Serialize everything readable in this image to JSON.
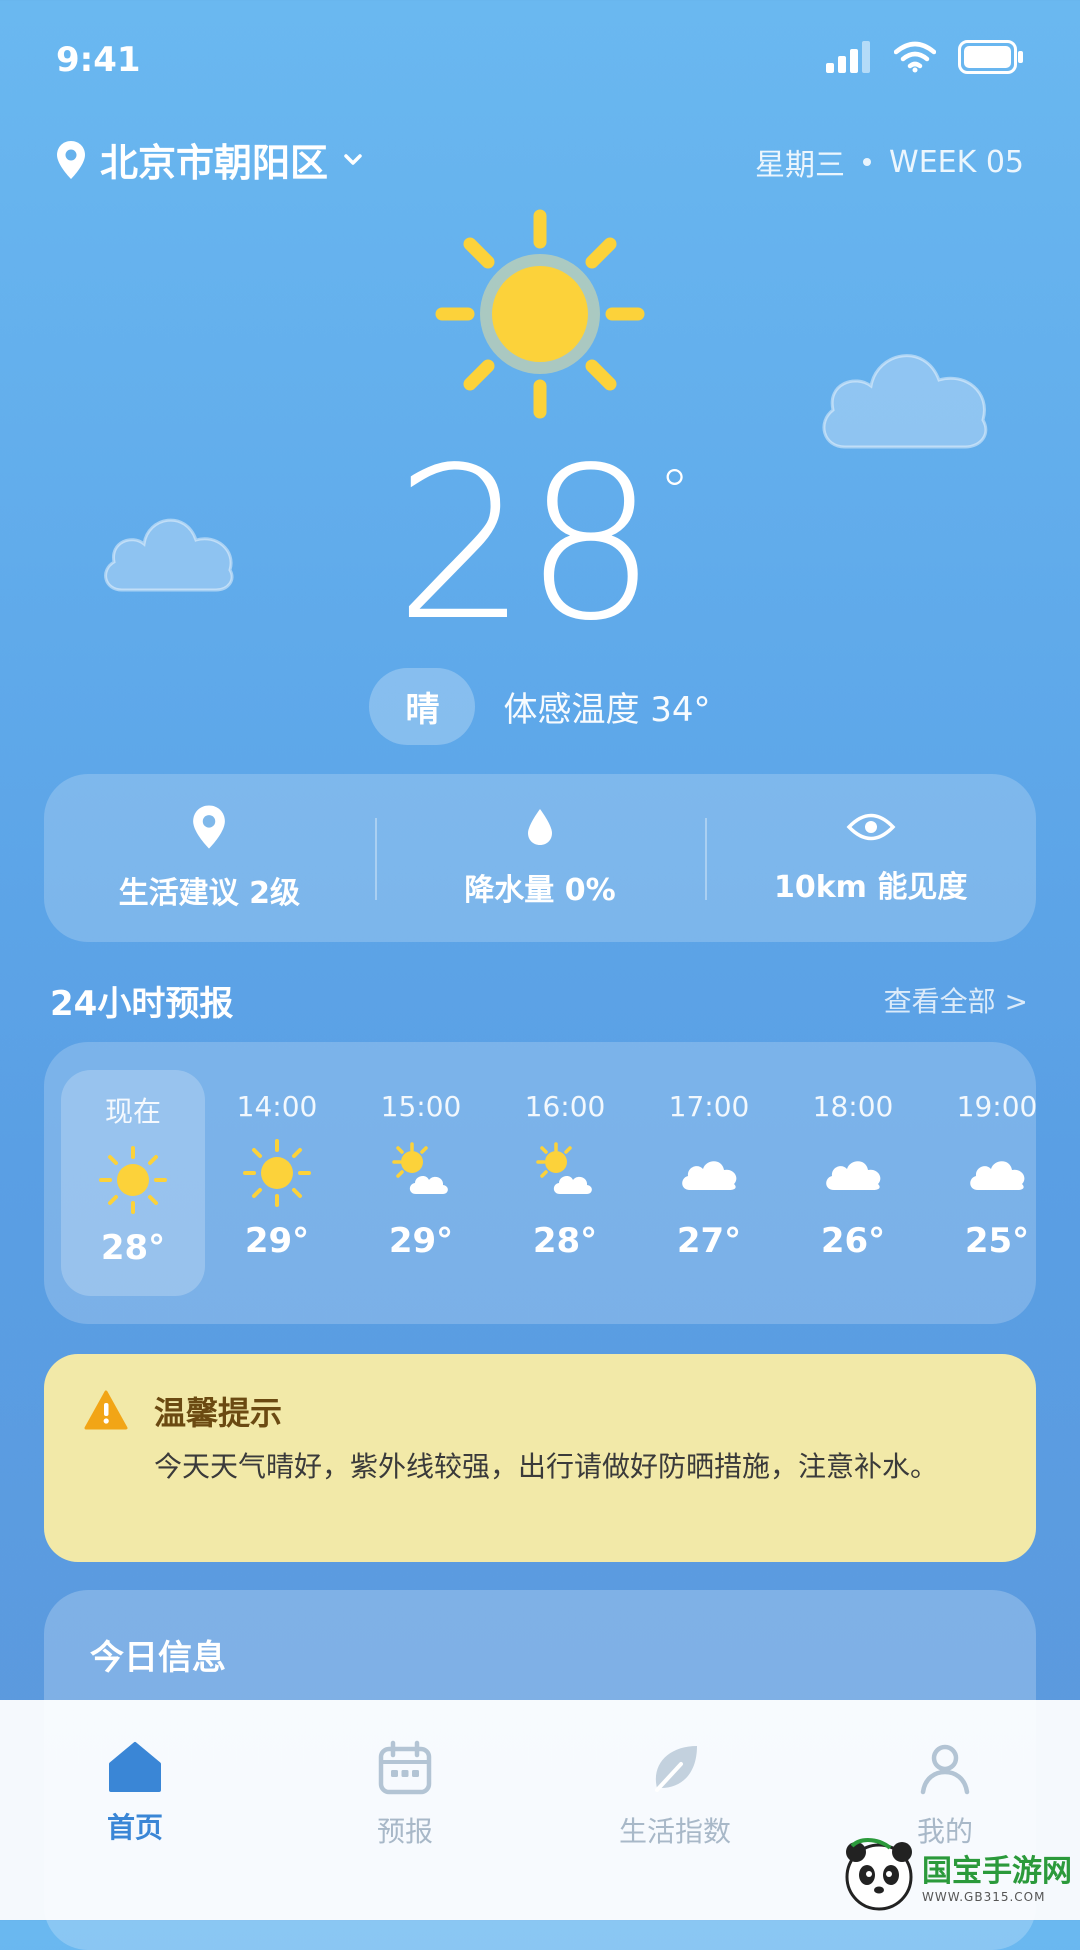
{
  "status_bar": {
    "time": "9:41"
  },
  "location": {
    "name": "北京市朝阳区"
  },
  "date": {
    "weekday": "星期三",
    "week": "WEEK 05"
  },
  "current": {
    "temperature": "28",
    "degree_symbol": "°",
    "condition": "晴",
    "feels_like": "体感温度 34°"
  },
  "stats": [
    {
      "icon": "location-pin-icon",
      "label": "生活建议 2级"
    },
    {
      "icon": "raindrop-icon",
      "label": "降水量 0%"
    },
    {
      "icon": "eye-icon",
      "label": "10km 能见度"
    }
  ],
  "hourly_section": {
    "title": "24小时预报",
    "see_all": "查看全部 >"
  },
  "hourly": [
    {
      "time": "现在",
      "icon": "sun-icon",
      "temp": "28°"
    },
    {
      "time": "14:00",
      "icon": "sun-icon",
      "temp": "29°"
    },
    {
      "time": "15:00",
      "icon": "partly-cloudy-icon",
      "temp": "29°"
    },
    {
      "time": "16:00",
      "icon": "partly-cloudy-icon",
      "temp": "28°"
    },
    {
      "time": "17:00",
      "icon": "cloud-icon",
      "temp": "27°"
    },
    {
      "time": "18:00",
      "icon": "cloud-icon",
      "temp": "26°"
    },
    {
      "time": "19:00",
      "icon": "cloud-icon",
      "temp": "25°"
    }
  ],
  "tip": {
    "title": "温馨提示",
    "body": "今天天气晴好，紫外线较强，出行请做好防晒措施，注意补水。"
  },
  "today_info": {
    "title": "今日信息"
  },
  "nav": [
    {
      "label": "首页",
      "icon": "home-icon",
      "active": true
    },
    {
      "label": "预报",
      "icon": "calendar-icon",
      "active": false
    },
    {
      "label": "生活指数",
      "icon": "leaf-icon",
      "active": false
    },
    {
      "label": "我的",
      "icon": "user-icon",
      "active": false
    }
  ],
  "watermark": {
    "brand": "国宝手游网",
    "url": "WWW.GB315.COM"
  },
  "colors": {
    "accent": "#3a86d6",
    "sun": "#fcd23a",
    "tip_bg": "#f2e9a8",
    "tip_icon": "#f2a516"
  }
}
